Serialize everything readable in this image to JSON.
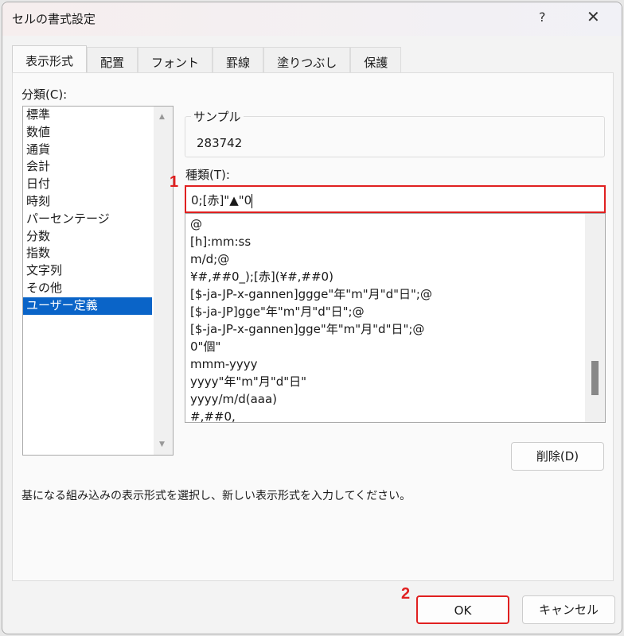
{
  "window": {
    "title": "セルの書式設定",
    "help": "?",
    "close": "✕"
  },
  "tabs": [
    "表示形式",
    "配置",
    "フォント",
    "罫線",
    "塗りつぶし",
    "保護"
  ],
  "category": {
    "label": "分類(C):",
    "items": [
      "標準",
      "数値",
      "通貨",
      "会計",
      "日付",
      "時刻",
      "パーセンテージ",
      "分数",
      "指数",
      "文字列",
      "その他",
      "ユーザー定義"
    ],
    "selected": "ユーザー定義"
  },
  "sample": {
    "label": "サンプル",
    "value": "283742"
  },
  "type": {
    "label": "種類(T):",
    "value": "0;[赤]\"▲\"0"
  },
  "formats": [
    "@",
    "[h]:mm:ss",
    "m/d;@",
    "¥#,##0_);[赤](¥#,##0)",
    "[$-ja-JP-x-gannen]ggge\"年\"m\"月\"d\"日\";@",
    "[$-ja-JP]gge\"年\"m\"月\"d\"日\";@",
    "[$-ja-JP-x-gannen]gge\"年\"m\"月\"d\"日\";@",
    "0\"個\"",
    "mmm-yyyy",
    "yyyy\"年\"m\"月\"d\"日\"",
    "yyyy/m/d(aaa)",
    "#,##0,"
  ],
  "buttons": {
    "delete": "削除(D)",
    "ok": "OK",
    "cancel": "キャンセル"
  },
  "description": "基になる組み込みの表示形式を選択し、新しい表示形式を入力してください。",
  "markers": {
    "m1": "1",
    "m2": "2"
  },
  "colors": {
    "highlight": "#e02020",
    "selection": "#0a64c8"
  }
}
